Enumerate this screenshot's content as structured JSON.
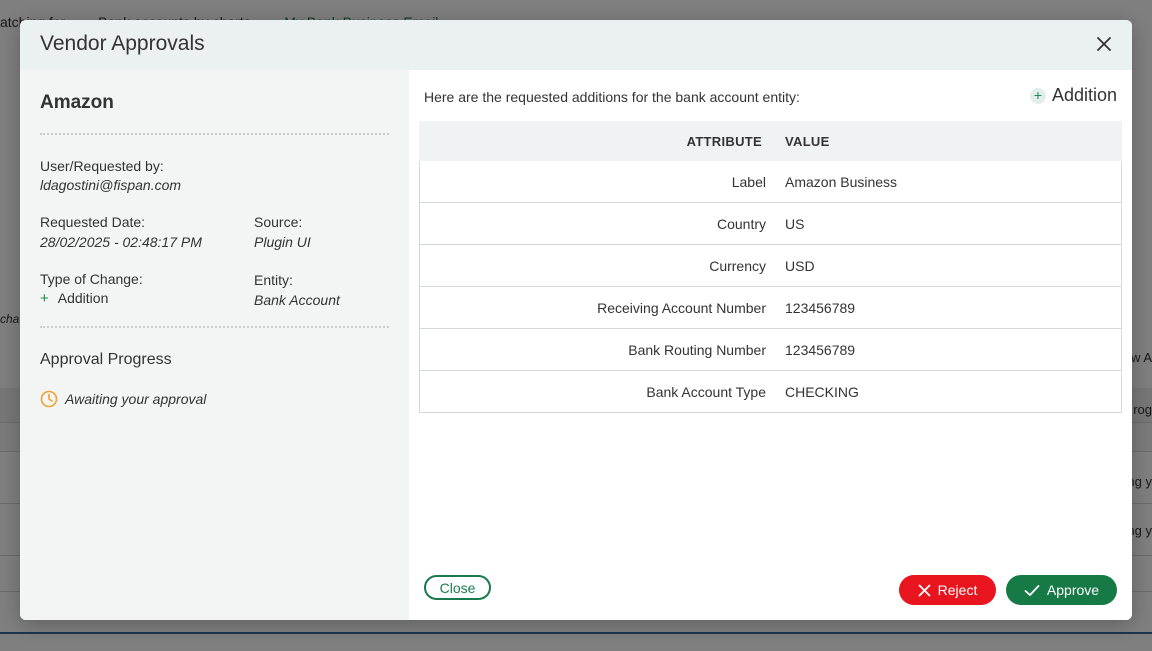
{
  "background": {
    "tabs": [
      "atching for...",
      "Bank accounts by charts...",
      "My Bank Business Email"
    ],
    "left_text": "cha",
    "right_texts": [
      "w A",
      "rog",
      "ng y",
      "ng y"
    ]
  },
  "modal": {
    "title": "Vendor Approvals",
    "close_icon": "close-icon"
  },
  "details": {
    "vendor_name": "Amazon",
    "requested_by_label": "User/Requested by:",
    "requested_by_value": "ldagostini@fispan.com",
    "requested_date_label": "Requested Date:",
    "requested_date_value": "28/02/2025 - 02:48:17 PM",
    "source_label": "Source:",
    "source_value": "Plugin UI",
    "type_label": "Type of Change:",
    "type_value": "Addition",
    "entity_label": "Entity:",
    "entity_value": "Bank Account",
    "progress_title": "Approval Progress",
    "progress_status": "Awaiting your approval"
  },
  "requested": {
    "intro": "Here are the requested additions for the bank account entity:",
    "addition_label": "Addition",
    "headers": {
      "attribute": "ATTRIBUTE",
      "value": "VALUE"
    },
    "rows": [
      {
        "attribute": "Label",
        "value": "Amazon Business"
      },
      {
        "attribute": "Country",
        "value": "US"
      },
      {
        "attribute": "Currency",
        "value": "USD"
      },
      {
        "attribute": "Receiving Account Number",
        "value": "123456789"
      },
      {
        "attribute": "Bank Routing Number",
        "value": "123456789"
      },
      {
        "attribute": "Bank Account Type",
        "value": "CHECKING"
      }
    ]
  },
  "footer": {
    "close_label": "Close",
    "reject_label": "Reject",
    "approve_label": "Approve"
  },
  "colors": {
    "accent_green": "#1a7a4f",
    "approve_green": "#157a45",
    "reject_red": "#e8141e",
    "warning_orange": "#f0a030"
  }
}
